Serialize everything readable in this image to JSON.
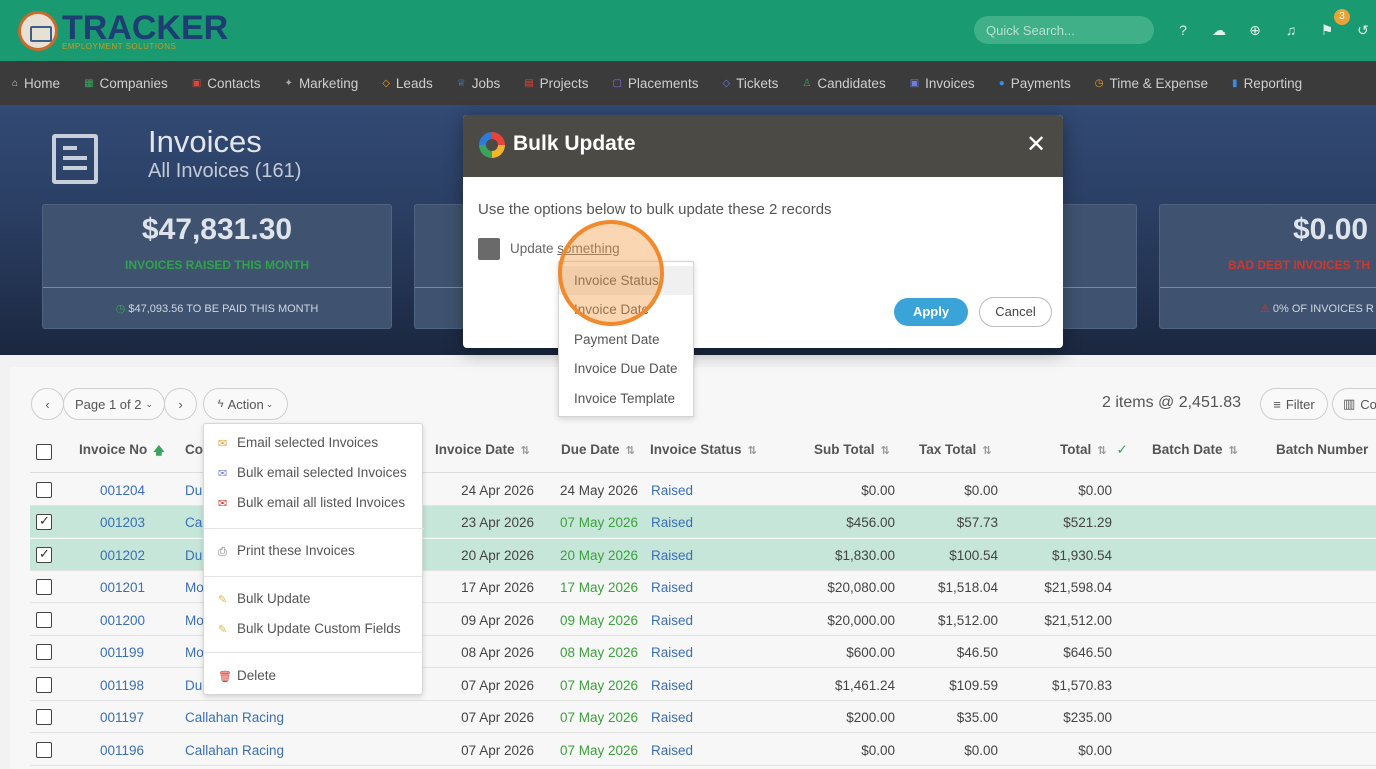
{
  "header": {
    "logo_main": "TRACKER",
    "logo_sub": "EMPLOYMENT SOLUTIONS",
    "search_placeholder": "Quick Search...",
    "notification_badge": "3"
  },
  "nav": [
    "Home",
    "Companies",
    "Contacts",
    "Marketing",
    "Leads",
    "Jobs",
    "Projects",
    "Placements",
    "Tickets",
    "Candidates",
    "Invoices",
    "Payments",
    "Time & Expense",
    "Reporting"
  ],
  "hero": {
    "title": "Invoices",
    "subtitle": "All Invoices (161)",
    "stats": [
      {
        "value": "$47,831.30",
        "label": "INVOICES RAISED THIS MONTH",
        "label_color": "#2fa34a",
        "footer": "$47,093.56 TO BE PAID THIS MONTH"
      },
      {
        "value": "",
        "label": "",
        "label_color": "#2fa34a",
        "footer": ""
      },
      {
        "value": "",
        "label": "",
        "label_color": "#2fa34a",
        "footer": ""
      },
      {
        "value": "$0.00",
        "label": "BAD DEBT INVOICES TH",
        "label_color": "#d2362c",
        "footer": "0% OF INVOICES R"
      }
    ]
  },
  "toolbar": {
    "page_label": "Page 1 of 2",
    "action_label": "Action",
    "items_count": "2 items @ 2,451.83",
    "filter_label": "Filter",
    "columns_label": "Co"
  },
  "action_menu": [
    "Email selected Invoices",
    "Bulk email selected Invoices",
    "Bulk email all listed Invoices",
    "Print these Invoices",
    "Bulk Update",
    "Bulk Update Custom Fields",
    "Delete"
  ],
  "table": {
    "headers": {
      "invoice_no": "Invoice No",
      "company": "Co",
      "invoice_date": "Invoice Date",
      "due_date": "Due Date",
      "status": "Invoice Status",
      "sub_total": "Sub Total",
      "tax_total": "Tax Total",
      "total": "Total",
      "batch_date": "Batch Date",
      "batch_number": "Batch Number"
    },
    "rows": [
      {
        "no": "001204",
        "company": "Du",
        "invoice_date": "24 Apr 2026",
        "due_date": "24 May 2026",
        "status": "Raised",
        "sub_total": "$0.00",
        "tax_total": "$0.00",
        "total": "$0.00",
        "selected": false
      },
      {
        "no": "001203",
        "company": "Ca",
        "invoice_date": "23 Apr 2026",
        "due_date": "07 May 2026",
        "status": "Raised",
        "sub_total": "$456.00",
        "tax_total": "$57.73",
        "total": "$521.29",
        "selected": true
      },
      {
        "no": "001202",
        "company": "Du",
        "invoice_date": "20 Apr 2026",
        "due_date": "20 May 2026",
        "status": "Raised",
        "sub_total": "$1,830.00",
        "tax_total": "$100.54",
        "total": "$1,930.54",
        "selected": true
      },
      {
        "no": "001201",
        "company": "Mo",
        "invoice_date": "17 Apr 2026",
        "due_date": "17 May 2026",
        "status": "Raised",
        "sub_total": "$20,080.00",
        "tax_total": "$1,518.04",
        "total": "$21,598.04",
        "selected": false
      },
      {
        "no": "001200",
        "company": "Mo",
        "invoice_date": "09 Apr 2026",
        "due_date": "09 May 2026",
        "status": "Raised",
        "sub_total": "$20,000.00",
        "tax_total": "$1,512.00",
        "total": "$21,512.00",
        "selected": false
      },
      {
        "no": "001199",
        "company": "Mo",
        "invoice_date": "08 Apr 2026",
        "due_date": "08 May 2026",
        "status": "Raised",
        "sub_total": "$600.00",
        "tax_total": "$46.50",
        "total": "$646.50",
        "selected": false
      },
      {
        "no": "001198",
        "company": "Du",
        "invoice_date": "07 Apr 2026",
        "due_date": "07 May 2026",
        "status": "Raised",
        "sub_total": "$1,461.24",
        "tax_total": "$109.59",
        "total": "$1,570.83",
        "selected": false
      },
      {
        "no": "001197",
        "company": "Callahan Racing",
        "invoice_date": "07 Apr 2026",
        "due_date": "07 May 2026",
        "status": "Raised",
        "sub_total": "$200.00",
        "tax_total": "$35.00",
        "total": "$235.00",
        "selected": false
      },
      {
        "no": "001196",
        "company": "Callahan Racing",
        "invoice_date": "07 Apr 2026",
        "due_date": "07 May 2026",
        "status": "Raised",
        "sub_total": "$0.00",
        "tax_total": "$0.00",
        "total": "$0.00",
        "selected": false
      }
    ]
  },
  "modal": {
    "title": "Bulk Update",
    "close": "✕",
    "description": "Use the options below to bulk update these 2 records",
    "update_prefix": "Update ",
    "update_link": "something",
    "apply": "Apply",
    "cancel": "Cancel",
    "options": [
      "Invoice Status",
      "Invoice Date",
      "Payment Date",
      "Invoice Due Date",
      "Invoice Template"
    ]
  },
  "colors": {
    "brand_green": "#1a9a70",
    "nav_bg": "#3b3b3b",
    "apply_blue": "#3aa4d8",
    "selected_row": "#c6e6da",
    "highlight_ring": "#f08a2c"
  }
}
